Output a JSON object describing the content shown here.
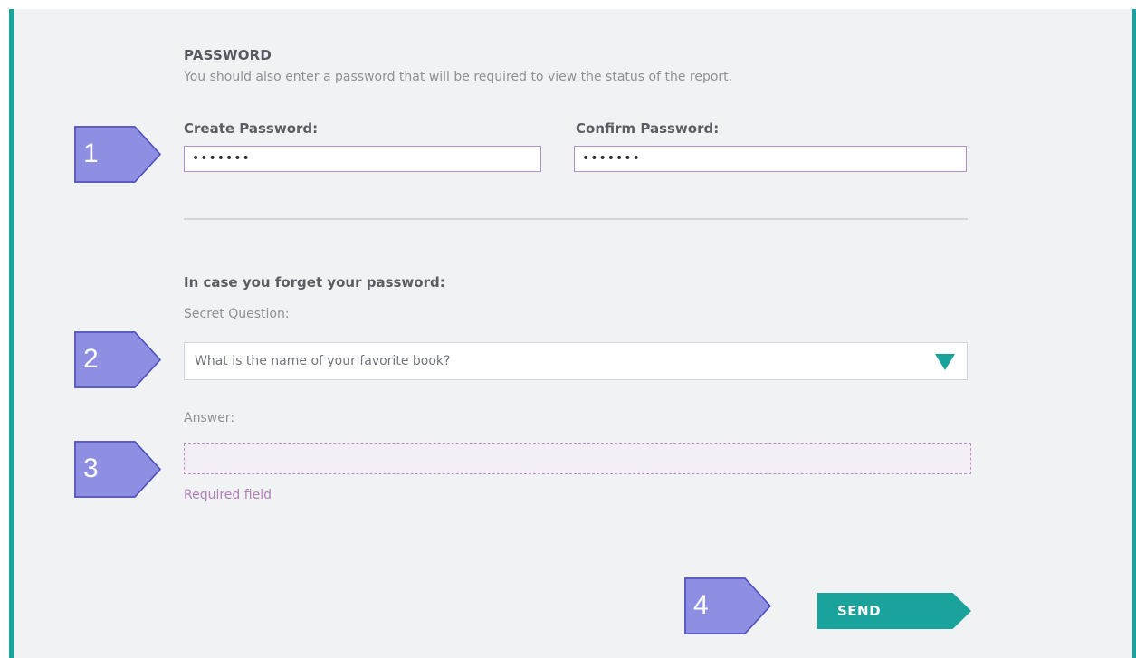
{
  "password_section": {
    "title": "PASSWORD",
    "description": "You should also enter a password that will be required to view the status of the report.",
    "create_label": "Create Password:",
    "create_value": "•••••••",
    "confirm_label": "Confirm Password:",
    "confirm_value": "•••••••"
  },
  "recovery_section": {
    "title": "In case you forget your password:",
    "question_label": "Secret Question:",
    "question_value": "What is the name of your favorite book?",
    "answer_label": "Answer:",
    "answer_value": "",
    "required_text": "Required field"
  },
  "actions": {
    "send_label": "SEND"
  },
  "callouts": [
    "1",
    "2",
    "3",
    "4"
  ],
  "colors": {
    "accent": "#1aa39c",
    "callout": "#8e8fe2",
    "input_border": "#b58fc3",
    "required": "#b07fb6",
    "panel_bg": "#f1f2f4"
  },
  "icons": {
    "dropdown": "triangle-down-icon"
  }
}
